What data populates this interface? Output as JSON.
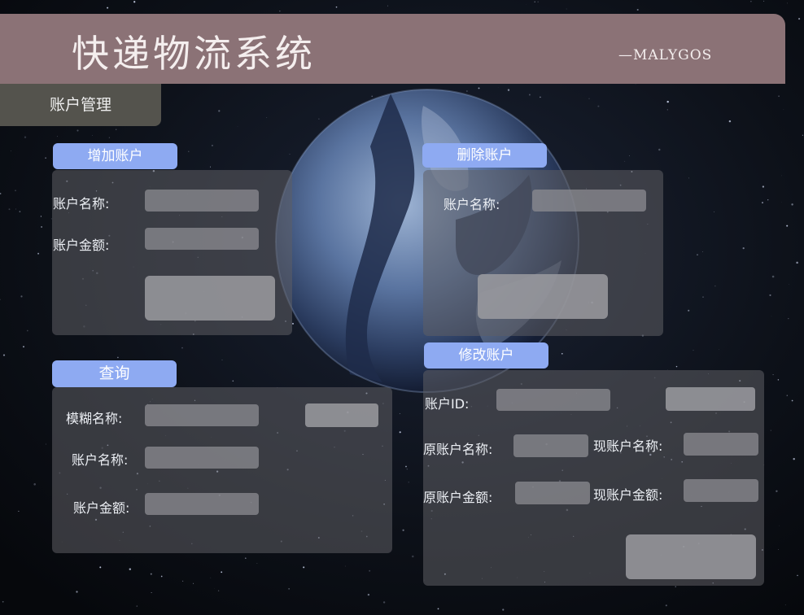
{
  "header": {
    "title": "快递物流系统",
    "subtitle": "—MALYGOS"
  },
  "section": {
    "title": "账户管理"
  },
  "add_panel": {
    "title": "增加账户",
    "name_label": "账户名称:",
    "amount_label": "账户金额:",
    "name_value": "",
    "amount_value": "",
    "submit_label": ""
  },
  "delete_panel": {
    "title": "删除账户",
    "name_label": "账户名称:",
    "name_value": "",
    "submit_label": ""
  },
  "query_panel": {
    "title": "查询",
    "fuzzy_label": "模糊名称:",
    "name_label": "账户名称:",
    "amount_label": "账户金额:",
    "fuzzy_value": "",
    "name_value": "",
    "amount_value": "",
    "search_label": ""
  },
  "modify_panel": {
    "title": "修改账户",
    "id_label": "账户ID:",
    "orig_name_label": "原账户名称:",
    "new_name_label": "现账户名称:",
    "orig_amount_label": "原账户金额:",
    "new_amount_label": "现账户金额:",
    "id_value": "",
    "orig_name_value": "",
    "new_name_value": "",
    "orig_amount_value": "",
    "new_amount_value": "",
    "lookup_label": "",
    "submit_label": ""
  },
  "colors": {
    "header": "#8b7276",
    "tab_bg": "#54534d",
    "panel_title": "#8eaaf2",
    "background": "#0a0d14"
  }
}
